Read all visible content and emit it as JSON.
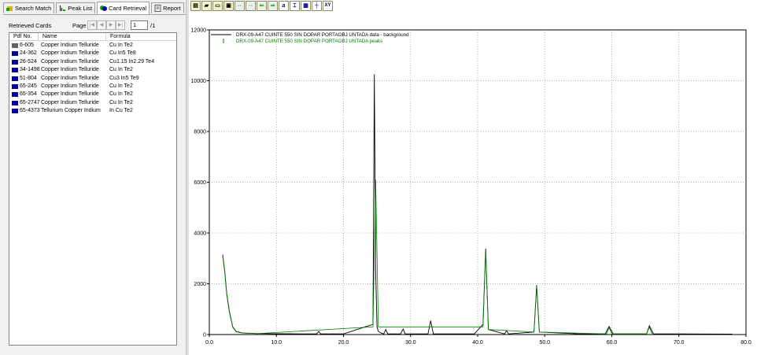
{
  "tabs": [
    {
      "label": "Search Match",
      "icon": "search-match-icon"
    },
    {
      "label": "Peak List",
      "icon": "peak-list-icon"
    },
    {
      "label": "Card Retrieval",
      "icon": "card-retrieval-icon"
    },
    {
      "label": "Report",
      "icon": "report-icon"
    }
  ],
  "retrieved_label": "Retrieved Cards",
  "page_label": "Page",
  "page_value": "1",
  "page_total": "/1",
  "columns": [
    "Pdf No.",
    "Name",
    "Formula"
  ],
  "cards": [
    {
      "pdf": "6-605",
      "name": "Copper Indium Telluride",
      "formula": "Cu In Te2",
      "selected": true
    },
    {
      "pdf": "24-362",
      "name": "Copper Indium Telluride",
      "formula": "Cu In5 Te8"
    },
    {
      "pdf": "26-524",
      "name": "Copper Indium Telluride",
      "formula": "Cu1.15 In2.29 Te4"
    },
    {
      "pdf": "34-1498",
      "name": "Copper Indium Telluride",
      "formula": "Cu In Te2"
    },
    {
      "pdf": "51-804",
      "name": "Copper Indium Telluride",
      "formula": "Cu3 In5 Te9"
    },
    {
      "pdf": "65-245",
      "name": "Copper Indium Telluride",
      "formula": "Cu In Te2"
    },
    {
      "pdf": "65-354",
      "name": "Copper Indium Telluride",
      "formula": "Cu In Te2"
    },
    {
      "pdf": "65-2747",
      "name": "Copper Indium Telluride",
      "formula": "Cu In Te2"
    },
    {
      "pdf": "65-4373",
      "name": "Tellurium Copper Indium",
      "formula": "In Cu Te2"
    }
  ],
  "chart_data": {
    "type": "line",
    "xlim": [
      0,
      80
    ],
    "ylim": [
      0,
      12000
    ],
    "xticks": [
      "0.0",
      "10.0",
      "20.0",
      "30.0",
      "40.0",
      "50.0",
      "60.0",
      "70.0",
      "80.0"
    ],
    "yticks": [
      "0",
      "2000",
      "4000",
      "6000",
      "8000",
      "10000",
      "12000"
    ],
    "grid": true,
    "legend_position": "top-left",
    "series": [
      {
        "name": "DRX-09-A47 CUINTE 550 SIN DOPAR PORTAOBJ UNTADA data - background",
        "color": "#000000",
        "x": [
          2.0,
          2.3,
          2.6,
          3.0,
          3.5,
          4.0,
          5.0,
          7.0,
          10.0,
          15.0,
          16.0,
          16.3,
          16.6,
          20.0,
          24.4,
          24.6,
          24.8,
          25.0,
          25.2,
          25.6,
          26.0,
          26.3,
          26.6,
          28.5,
          28.9,
          29.2,
          32.6,
          33.0,
          33.4,
          37.0,
          39.5,
          40.8,
          41.2,
          41.6,
          44.0,
          44.3,
          44.6,
          48.4,
          48.8,
          49.2,
          55.0,
          59.0,
          59.6,
          60.2,
          65.2,
          65.6,
          66.2,
          70.0,
          78.0
        ],
        "y": [
          3150,
          2500,
          1600,
          900,
          300,
          120,
          60,
          40,
          30,
          25,
          25,
          120,
          25,
          25,
          400,
          10250,
          2500,
          300,
          120,
          60,
          25,
          200,
          25,
          25,
          220,
          25,
          25,
          550,
          25,
          25,
          25,
          400,
          3380,
          200,
          25,
          150,
          25,
          100,
          1950,
          100,
          25,
          25,
          320,
          25,
          25,
          350,
          25,
          25,
          15
        ]
      },
      {
        "name": "DRX-09-A47 CUINTE 550 SIN DOPAR PORTAOBJ UNTADA peaks",
        "color": "#008000",
        "x": [
          2.0,
          2.3,
          2.6,
          3.0,
          3.5,
          4.0,
          5.0,
          7.0,
          24.4,
          24.8,
          25.2,
          40.8,
          41.2,
          41.6,
          48.4,
          48.8,
          49.2,
          59.2,
          59.6,
          60.0,
          65.2,
          65.6,
          66.0
        ],
        "y": [
          3100,
          2450,
          1550,
          860,
          280,
          110,
          55,
          35,
          300,
          6100,
          300,
          300,
          3300,
          200,
          100,
          1900,
          100,
          25,
          280,
          25,
          25,
          300,
          25
        ]
      }
    ]
  }
}
